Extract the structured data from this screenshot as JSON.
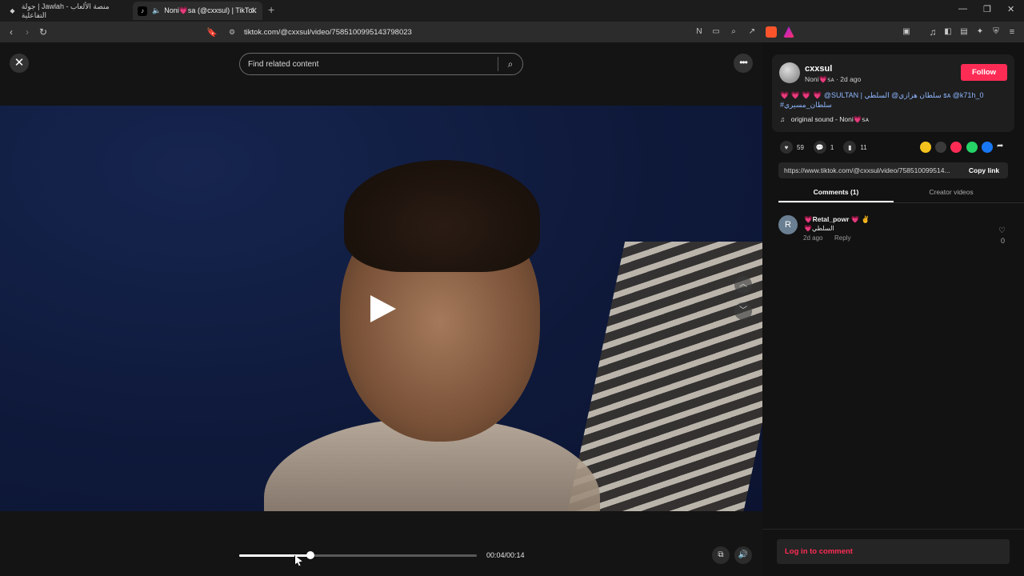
{
  "browser": {
    "tabs": [
      {
        "title": "جولة | Jawlah - منصة الألعاب التفاعلية",
        "favicon": "jawlah-icon"
      },
      {
        "title": "Noni💗sa (@cxxsul) | TikTok",
        "favicon": "tiktok-icon",
        "active": true
      }
    ],
    "new_tab": "+",
    "url": "tiktok.com/@cxxsul/video/7585100995143798023"
  },
  "player": {
    "search_placeholder": "Find related content",
    "current_time": "00:04",
    "duration": "00:14",
    "time_display": "00:04/00:14",
    "progress_fraction": 0.3
  },
  "author": {
    "username": "cxxsul",
    "nickname_line": "Noni💗ꜱᴀ · 2d ago",
    "follow_label": "Follow"
  },
  "description": {
    "hearts": "💗 💗 💗 💗",
    "text": " @SULTAN | سلطان هزازي@ السلطي ꜱᴀ @k71h_0",
    "hashtag": "#سلطان_مسيري"
  },
  "sound": "original sound - Noni💗ꜱᴀ",
  "stats": {
    "likes": "59",
    "comments": "1",
    "saves": "11"
  },
  "share_colors": [
    "#f4c21e",
    "#3a3a3a",
    "#fe2c55",
    "#25d366",
    "#1877f2"
  ],
  "link": {
    "url": "https://www.tiktok.com/@cxxsul/video/758510099514...",
    "copy_label": "Copy link"
  },
  "panel_tabs": {
    "comments": "Comments (1)",
    "creator_videos": "Creator videos"
  },
  "comments": [
    {
      "avatar_letter": "R",
      "user": "💗Retal_powr 💗 ✌",
      "text": "💗السلطي",
      "time": "2d ago",
      "reply": "Reply",
      "likes": "0"
    }
  ],
  "login_prompt": "Log in to comment"
}
